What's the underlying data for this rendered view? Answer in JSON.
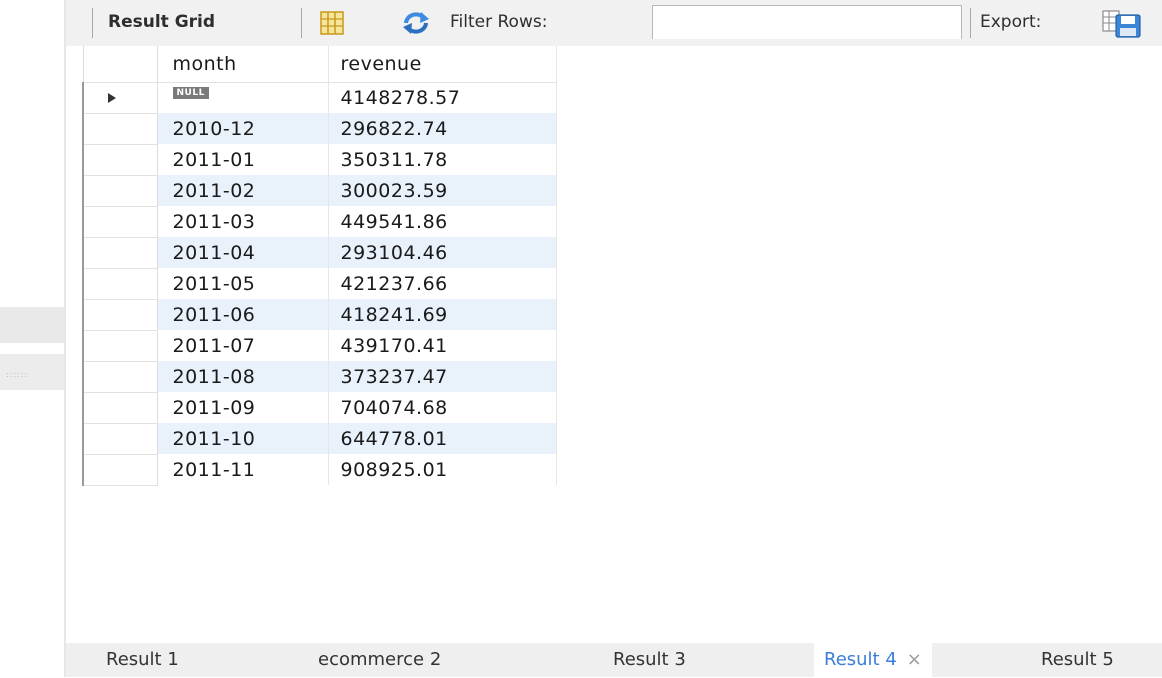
{
  "toolbar": {
    "result_grid_label": "Result Grid",
    "filter_label": "Filter Rows:",
    "filter_value": "",
    "export_label": "Export:"
  },
  "grid": {
    "columns": [
      "month",
      "revenue"
    ],
    "null_label": "NULL",
    "rows": [
      {
        "month": null,
        "revenue": "4148278.57"
      },
      {
        "month": "2010-12",
        "revenue": "296822.74"
      },
      {
        "month": "2011-01",
        "revenue": "350311.78"
      },
      {
        "month": "2011-02",
        "revenue": "300023.59"
      },
      {
        "month": "2011-03",
        "revenue": "449541.86"
      },
      {
        "month": "2011-04",
        "revenue": "293104.46"
      },
      {
        "month": "2011-05",
        "revenue": "421237.66"
      },
      {
        "month": "2011-06",
        "revenue": "418241.69"
      },
      {
        "month": "2011-07",
        "revenue": "439170.41"
      },
      {
        "month": "2011-08",
        "revenue": "373237.47"
      },
      {
        "month": "2011-09",
        "revenue": "704074.68"
      },
      {
        "month": "2011-10",
        "revenue": "644778.01"
      },
      {
        "month": "2011-11",
        "revenue": "908925.01"
      }
    ]
  },
  "tabs": [
    {
      "label": "Result 1",
      "active": false
    },
    {
      "label": "ecommerce 2",
      "active": false
    },
    {
      "label": "Result 3",
      "active": false
    },
    {
      "label": "Result 4",
      "active": true
    },
    {
      "label": "Result 5",
      "active": false
    }
  ],
  "tab_close_glyph": "×",
  "colors": {
    "active_tab": "#3b7dd8",
    "alt_row": "#e9f1fb",
    "toolbar_bg": "#f1f1f1",
    "null_badge": "#7a7a7a"
  },
  "icons": [
    "grid-layout-icon",
    "refresh-icon",
    "export-save-icon",
    "row-pointer-icon",
    "splitter-grip-icon"
  ]
}
